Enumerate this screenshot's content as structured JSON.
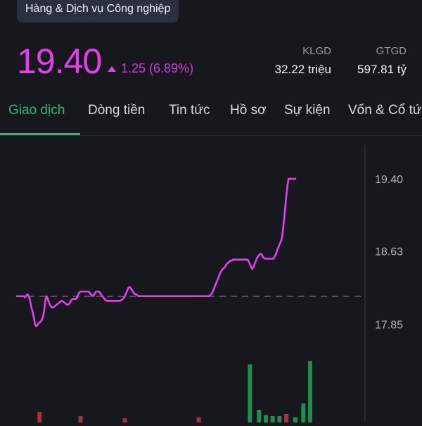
{
  "sector_chip": "Hàng & Dịch vụ Công nghiệp",
  "quote": {
    "price": "19.40",
    "change_text": "1.25 (6.89%)",
    "klgd_label": "KLGD",
    "klgd_value": "32.22 triệu",
    "gtgd_label": "GTGD",
    "gtgd_value": "597.81 tỷ"
  },
  "tabs": [
    {
      "label": "Giao dịch",
      "active": true
    },
    {
      "label": "Dòng tiền"
    },
    {
      "label": "Tin tức"
    },
    {
      "label": "Hồ sơ"
    },
    {
      "label": "Sự kiện"
    },
    {
      "label": "Vốn & Cổ tức"
    }
  ],
  "colors": {
    "price": "#e83cf0",
    "active_tab": "#2eb872",
    "volume_up": "#1f8f4e",
    "volume_down": "#a8323c",
    "reference_line": "#8a8a94"
  },
  "chart_data": {
    "type": "line",
    "ylim": [
      17.6,
      19.7
    ],
    "y_ticks": [
      "19.40",
      "18.63",
      "17.85"
    ],
    "reference_price": 18.15,
    "series": [
      {
        "values": [
          18.15,
          18.15,
          18.15,
          18.15,
          18.15,
          18.15,
          18.15,
          18.14,
          18.15,
          18.17,
          18.16,
          18.13,
          18.08,
          18.02,
          17.98,
          17.92,
          17.85,
          17.83,
          17.84,
          17.86,
          17.87,
          17.88,
          17.9,
          17.93,
          18.0,
          18.1,
          18.15,
          18.13,
          18.09,
          18.06,
          18.04,
          18.03,
          18.03,
          18.04,
          18.05,
          18.06,
          18.07,
          18.08,
          18.09,
          18.1,
          18.1,
          18.09,
          18.08,
          18.07,
          18.06,
          18.06,
          18.07,
          18.09,
          18.11,
          18.12,
          18.12,
          18.12,
          18.12,
          18.14,
          18.17,
          18.19,
          18.2,
          18.2,
          18.2,
          18.2,
          18.2,
          18.2,
          18.2,
          18.2,
          18.19,
          18.17,
          18.16,
          18.15,
          18.17,
          18.19,
          18.2,
          18.2,
          18.2,
          18.19,
          18.17,
          18.15,
          18.14,
          18.12,
          18.11,
          18.1,
          18.1,
          18.1,
          18.1,
          18.1,
          18.1,
          18.1,
          18.1,
          18.1,
          18.1,
          18.1,
          18.1,
          18.1,
          18.11,
          18.12,
          18.13,
          18.15,
          18.18,
          18.21,
          18.24,
          18.25,
          18.24,
          18.22,
          18.2,
          18.18,
          18.17,
          18.17,
          18.16,
          18.15,
          18.15,
          18.15,
          18.15,
          18.15,
          18.15,
          18.15,
          18.15,
          18.15,
          18.15,
          18.15,
          18.15,
          18.15,
          18.15,
          18.15,
          18.15,
          18.15,
          18.15,
          18.15,
          18.15,
          18.15,
          18.15,
          18.15,
          18.15,
          18.15,
          18.15,
          18.15,
          18.15,
          18.15,
          18.15,
          18.15,
          18.15,
          18.15,
          18.15,
          18.15,
          18.15,
          18.15,
          18.15,
          18.15,
          18.15,
          18.15,
          18.15,
          18.15,
          18.15,
          18.15,
          18.15,
          18.15,
          18.15,
          18.15,
          18.15,
          18.15,
          18.15,
          18.15,
          18.15,
          18.15,
          18.15,
          18.15,
          18.15,
          18.15,
          18.15,
          18.15,
          18.15,
          18.15,
          18.16,
          18.17,
          18.19,
          18.22,
          18.25,
          18.28,
          18.31,
          18.34,
          18.37,
          18.4,
          18.42,
          18.44,
          18.45,
          18.46,
          18.48,
          18.5,
          18.51,
          18.52,
          18.53,
          18.53,
          18.54,
          18.54,
          18.54,
          18.54,
          18.54,
          18.54,
          18.54,
          18.54,
          18.54,
          18.54,
          18.54,
          18.54,
          18.54,
          18.54,
          18.52,
          18.49,
          18.46,
          18.44,
          18.46,
          18.49,
          18.52,
          18.55,
          18.57,
          18.59,
          18.6,
          18.6,
          18.58,
          18.56,
          18.55,
          18.55,
          18.55,
          18.55,
          18.55,
          18.55,
          18.55,
          18.55,
          18.55,
          18.58,
          18.6,
          18.64,
          18.67,
          18.7,
          18.73,
          18.76,
          18.85,
          18.96,
          19.09,
          19.22,
          19.33,
          19.4,
          19.4,
          19.4,
          19.4,
          19.4,
          19.4,
          19.4
        ]
      }
    ],
    "volume": [
      {
        "i": 20,
        "v": 0.1,
        "up": false
      },
      {
        "i": 56,
        "v": 0.06,
        "up": false
      },
      {
        "i": 95,
        "v": 0.04,
        "up": false
      },
      {
        "i": 160,
        "v": 0.05,
        "up": false
      },
      {
        "i": 205,
        "v": 0.55,
        "up": true
      },
      {
        "i": 213,
        "v": 0.12,
        "up": true
      },
      {
        "i": 219,
        "v": 0.07,
        "up": true
      },
      {
        "i": 225,
        "v": 0.06,
        "up": true
      },
      {
        "i": 231,
        "v": 0.06,
        "up": true
      },
      {
        "i": 237,
        "v": 0.08,
        "up": false
      },
      {
        "i": 245,
        "v": 0.05,
        "up": true
      },
      {
        "i": 252,
        "v": 0.18,
        "up": true
      },
      {
        "i": 258,
        "v": 0.58,
        "up": true
      }
    ]
  }
}
